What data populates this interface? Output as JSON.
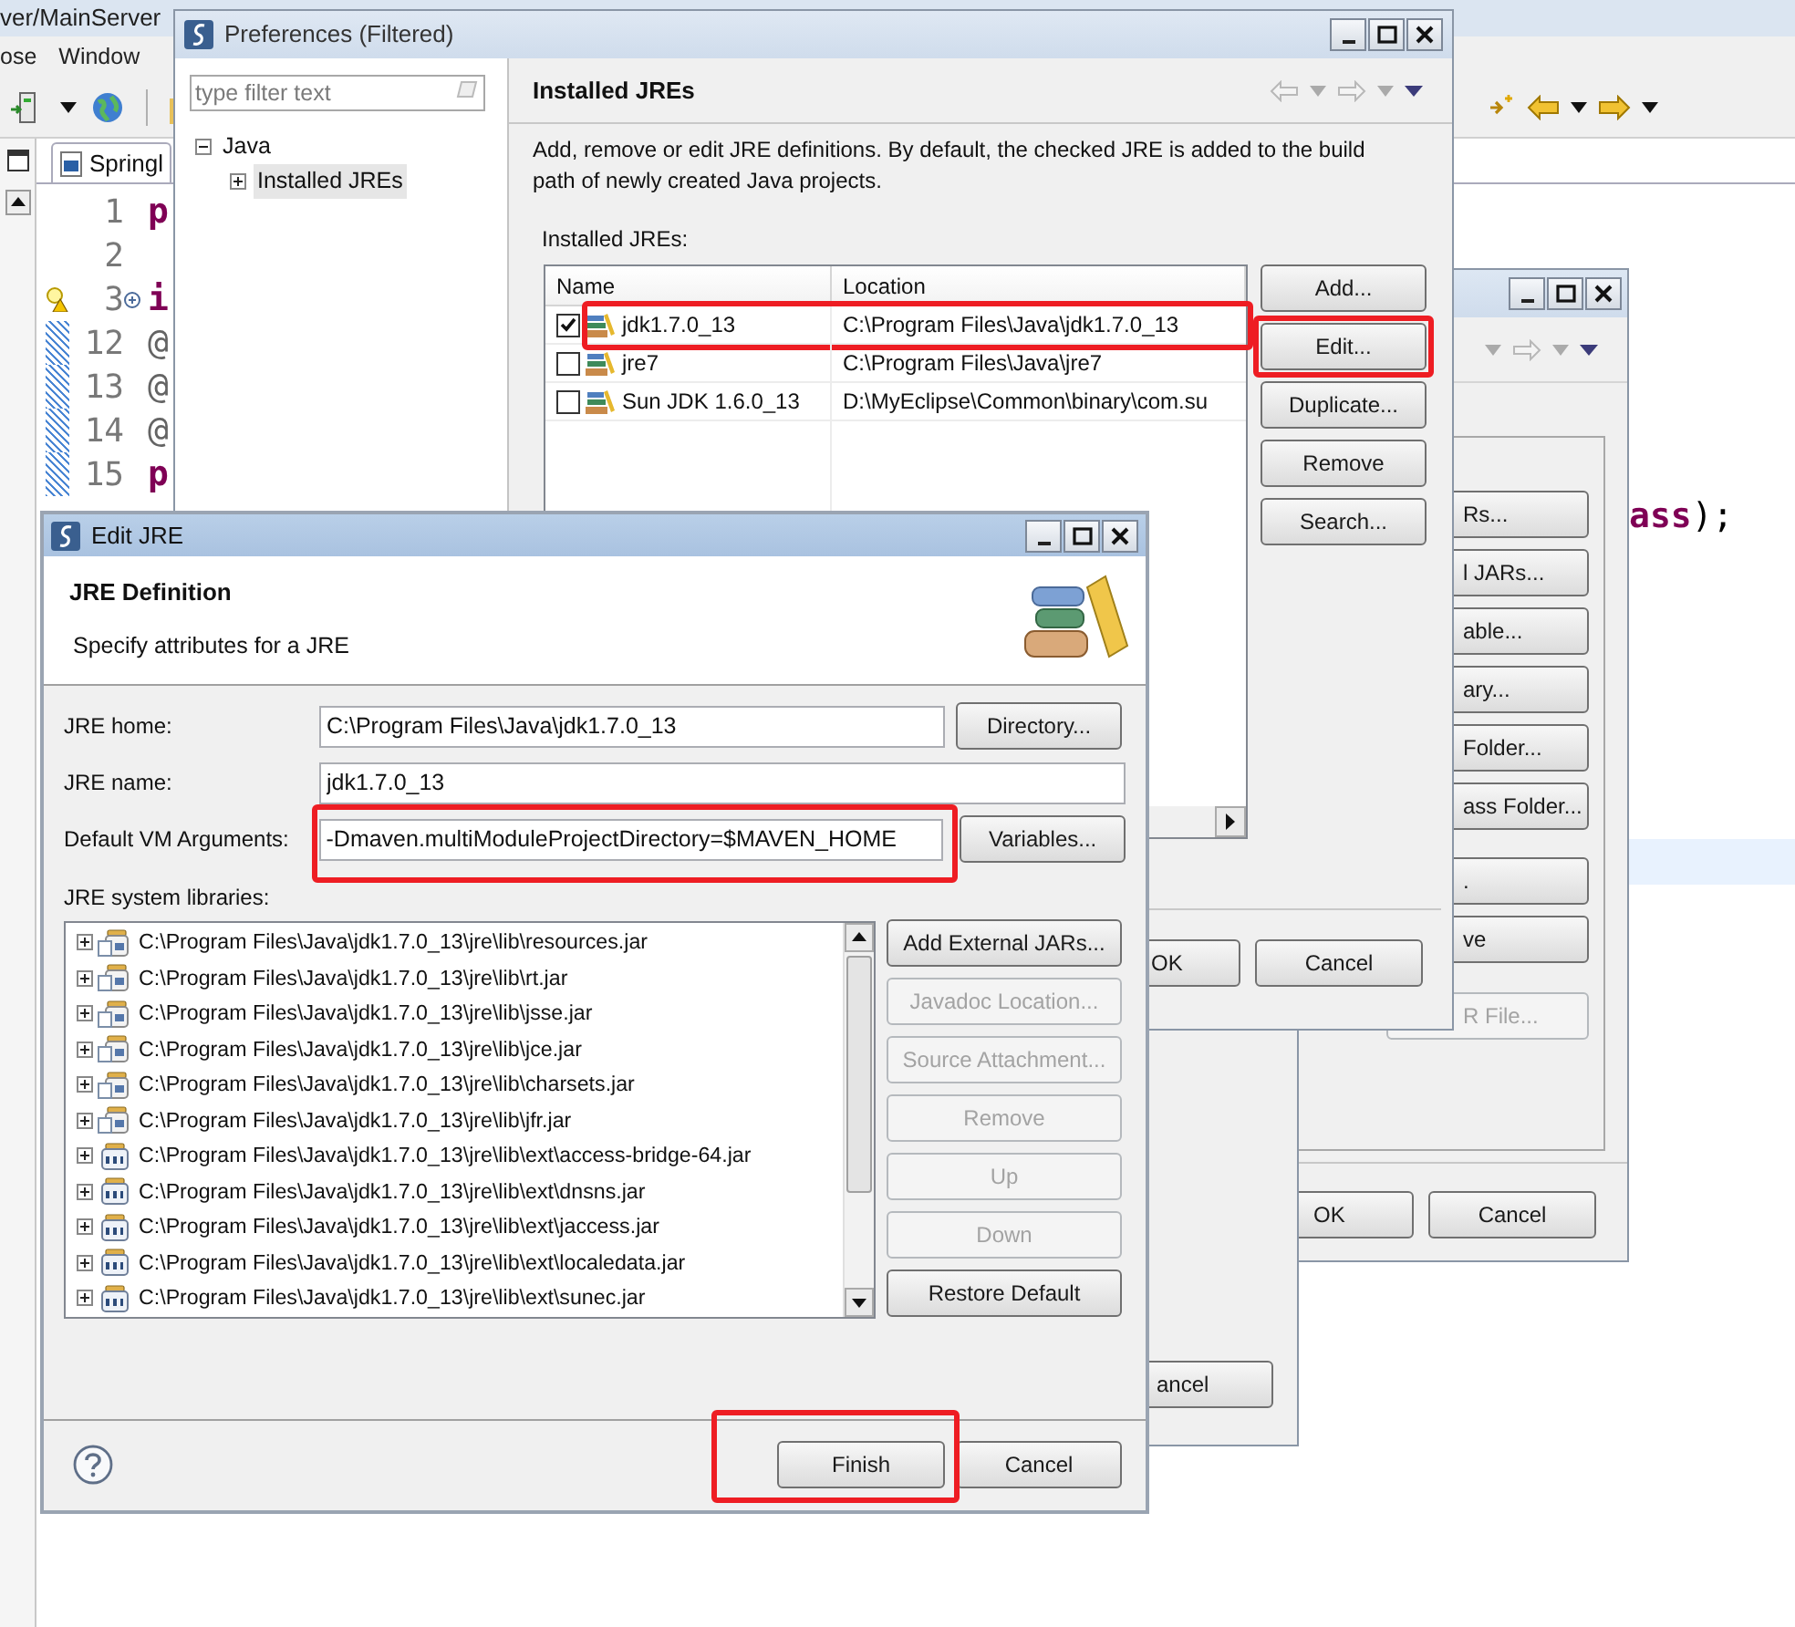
{
  "ide": {
    "title": "ver/MainServer",
    "menus": [
      "ose",
      "Window"
    ],
    "tab": "Springl",
    "lines": [
      {
        "number": "1",
        "text": "p",
        "kind": "keyword",
        "changed": false,
        "warning": false,
        "collapsed": false
      },
      {
        "number": "2",
        "changed": false,
        "warning": false,
        "collapsed": false
      },
      {
        "number": "3",
        "text": "i",
        "kind": "keyword",
        "changed": false,
        "warning": true,
        "collapsed": true
      },
      {
        "number": "12",
        "text": "@",
        "kind": "annotation",
        "changed": true,
        "warning": false,
        "collapsed": false
      },
      {
        "number": "13",
        "text": "@",
        "kind": "annotation",
        "changed": true,
        "warning": false,
        "collapsed": false
      },
      {
        "number": "14",
        "text": "@",
        "kind": "annotation",
        "changed": true,
        "warning": false,
        "collapsed": false
      },
      {
        "number": "15",
        "text": "p",
        "kind": "keyword",
        "changed": true,
        "warning": false,
        "collapsed": false
      }
    ],
    "tail": [
      {
        "text": "ass",
        "kind": "keyword"
      },
      {
        "text": ");",
        "kind": "plain"
      }
    ]
  },
  "dialog_behind": {
    "buttons": [
      {
        "label": "Rs...",
        "disabled": false
      },
      {
        "label": "l JARs...",
        "disabled": false
      },
      {
        "label": "able...",
        "disabled": false
      },
      {
        "label": "ary...",
        "disabled": false
      },
      {
        "label": "Folder...",
        "disabled": false
      },
      {
        "label": "ass Folder...",
        "disabled": false
      },
      {
        "label": ".",
        "disabled": false
      },
      {
        "label": "ve",
        "disabled": false
      },
      {
        "label": "R File...",
        "disabled": true
      }
    ],
    "ok": "OK",
    "cancel": "Cancel"
  },
  "dialog_lower": {
    "cancel": "ancel"
  },
  "preferences": {
    "title": "Preferences (Filtered)",
    "filter": {
      "placeholder": "type filter text"
    },
    "tree": [
      {
        "label": "Java",
        "expanded": true,
        "selected": false,
        "children": [
          {
            "label": "Installed JREs",
            "expanded": false,
            "selected": true
          }
        ]
      }
    ],
    "page_title": "Installed JREs",
    "description": "Add, remove or edit JRE definitions. By default, the checked JRE is added to the build path of newly created Java projects.",
    "table_label": "Installed JREs:",
    "columns": [
      "Name",
      "Location"
    ],
    "jres": [
      {
        "name": "jdk1.7.0_13",
        "location": "C:\\Program Files\\Java\\jdk1.7.0_13",
        "checked": true,
        "highlighted": true
      },
      {
        "name": "jre7",
        "location": "C:\\Program Files\\Java\\jre7",
        "checked": false,
        "highlighted": false
      },
      {
        "name": "Sun JDK 1.6.0_13",
        "location": "D:\\MyEclipse\\Common\\binary\\com.su",
        "checked": false,
        "highlighted": false
      }
    ],
    "buttons": [
      {
        "label": "Add...",
        "highlighted": false
      },
      {
        "label": "Edit...",
        "highlighted": true
      },
      {
        "label": "Duplicate...",
        "highlighted": false
      },
      {
        "label": "Remove",
        "highlighted": false
      },
      {
        "label": "Search...",
        "highlighted": false
      }
    ],
    "ok": "OK",
    "cancel": "Cancel"
  },
  "edit_jre": {
    "title": "Edit JRE",
    "heading": "JRE Definition",
    "subheading": "Specify attributes for a JRE",
    "fields": [
      {
        "label": "JRE home:",
        "value": "C:\\Program Files\\Java\\jdk1.7.0_13",
        "button": "Directory...",
        "highlighted": false
      },
      {
        "label": "JRE name:",
        "value": "jdk1.7.0_13",
        "highlighted": false
      },
      {
        "label": "Default VM Arguments:",
        "value": "-Dmaven.multiModuleProjectDirectory=$MAVEN_HOME",
        "button": "Variables...",
        "highlighted": true
      }
    ],
    "libraries_label": "JRE system libraries:",
    "libraries": [
      {
        "path": "C:\\Program Files\\Java\\jdk1.7.0_13\\jre\\lib\\resources.jar",
        "kind": "jar",
        "expanded": false
      },
      {
        "path": "C:\\Program Files\\Java\\jdk1.7.0_13\\jre\\lib\\rt.jar",
        "kind": "jar",
        "expanded": false
      },
      {
        "path": "C:\\Program Files\\Java\\jdk1.7.0_13\\jre\\lib\\jsse.jar",
        "kind": "jar",
        "expanded": false
      },
      {
        "path": "C:\\Program Files\\Java\\jdk1.7.0_13\\jre\\lib\\jce.jar",
        "kind": "jar",
        "expanded": false
      },
      {
        "path": "C:\\Program Files\\Java\\jdk1.7.0_13\\jre\\lib\\charsets.jar",
        "kind": "jar",
        "expanded": false
      },
      {
        "path": "C:\\Program Files\\Java\\jdk1.7.0_13\\jre\\lib\\jfr.jar",
        "kind": "jar",
        "expanded": false
      },
      {
        "path": "C:\\Program Files\\Java\\jdk1.7.0_13\\jre\\lib\\ext\\access-bridge-64.jar",
        "kind": "binary",
        "expanded": false
      },
      {
        "path": "C:\\Program Files\\Java\\jdk1.7.0_13\\jre\\lib\\ext\\dnsns.jar",
        "kind": "binary",
        "expanded": false
      },
      {
        "path": "C:\\Program Files\\Java\\jdk1.7.0_13\\jre\\lib\\ext\\jaccess.jar",
        "kind": "binary",
        "expanded": false
      },
      {
        "path": "C:\\Program Files\\Java\\jdk1.7.0_13\\jre\\lib\\ext\\localedata.jar",
        "kind": "binary",
        "expanded": false
      },
      {
        "path": "C:\\Program Files\\Java\\jdk1.7.0_13\\jre\\lib\\ext\\sunec.jar",
        "kind": "binary",
        "expanded": false
      }
    ],
    "library_buttons": [
      {
        "label": "Add External JARs...",
        "disabled": false
      },
      {
        "label": "Javadoc Location...",
        "disabled": true
      },
      {
        "label": "Source Attachment...",
        "disabled": true
      },
      {
        "label": "Remove",
        "disabled": true
      },
      {
        "label": "Up",
        "disabled": true
      },
      {
        "label": "Down",
        "disabled": true
      },
      {
        "label": "Restore Default",
        "disabled": false
      }
    ],
    "finish": {
      "label": "Finish",
      "highlighted": true
    },
    "cancel": "Cancel"
  }
}
